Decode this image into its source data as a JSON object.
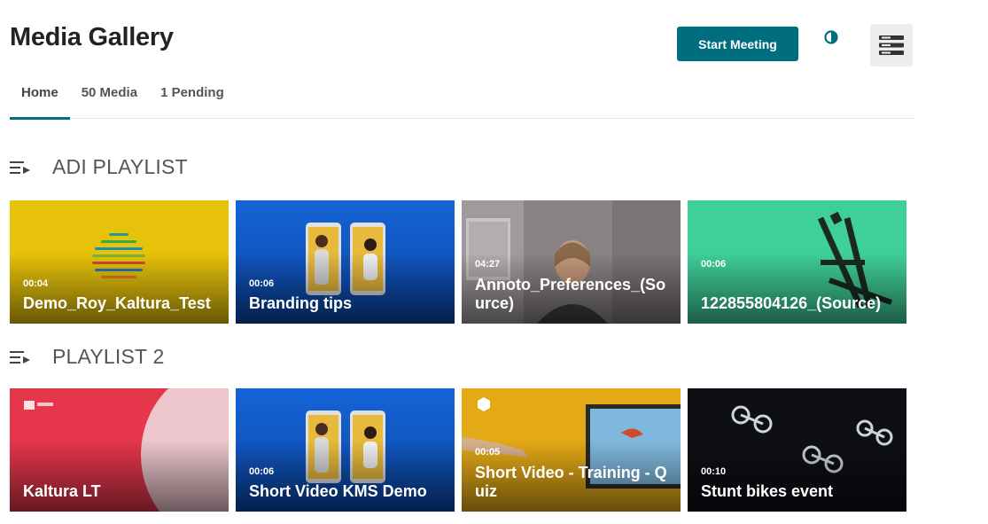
{
  "header": {
    "title": "Media Gallery",
    "start_meeting_label": "Start Meeting",
    "contrast_icon": "contrast-icon",
    "menu_icon": "menu-icon",
    "accent_color": "#006e7f"
  },
  "tabs": [
    {
      "label": "Home",
      "active": true
    },
    {
      "label": "50 Media",
      "active": false
    },
    {
      "label": "1 Pending",
      "active": false
    }
  ],
  "playlists": [
    {
      "title": "ADI PLAYLIST",
      "icon": "playlist-icon",
      "items": [
        {
          "duration": "00:04",
          "name": "Demo_Roy_Kaltura_Test"
        },
        {
          "duration": "00:06",
          "name": "Branding tips"
        },
        {
          "duration": "04:27",
          "name": "Annoto_Preferences_(Source)"
        },
        {
          "duration": "00:06",
          "name": "122855804126_(Source)"
        }
      ]
    },
    {
      "title": "PLAYLIST 2",
      "icon": "playlist-icon",
      "items": [
        {
          "duration": "",
          "name": "Kaltura LT"
        },
        {
          "duration": "00:06",
          "name": "Short Video KMS Demo"
        },
        {
          "duration": "00:05",
          "name": "Short Video - Training - Quiz"
        },
        {
          "duration": "00:10",
          "name": "Stunt bikes event"
        }
      ]
    }
  ]
}
